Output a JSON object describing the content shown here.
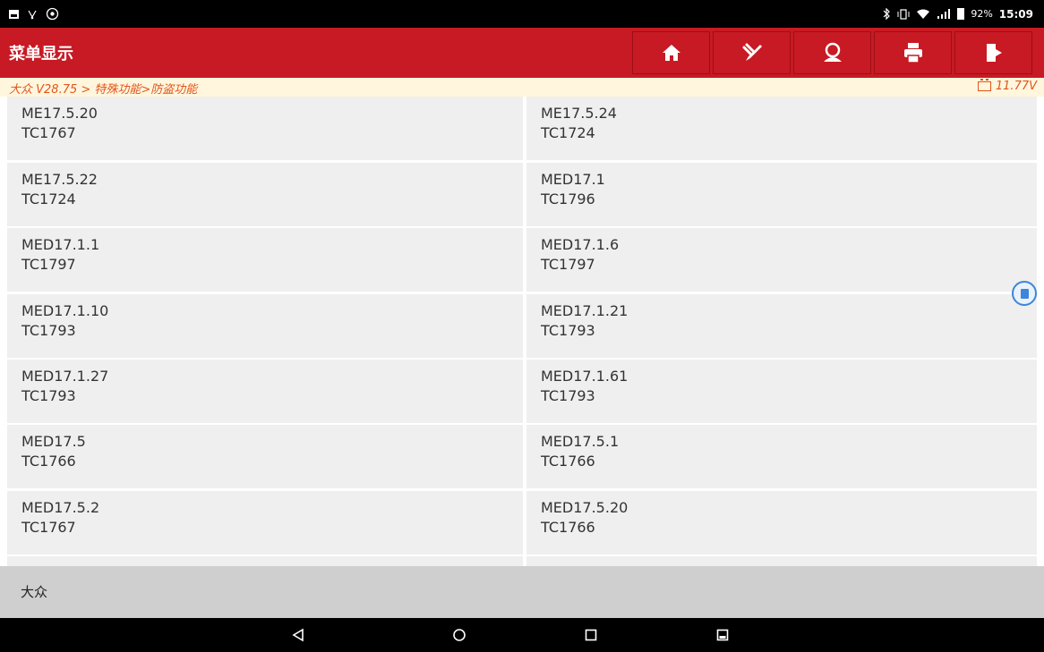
{
  "status_bar": {
    "icons": [
      "image-icon",
      "usb-icon",
      "settings-cog-icon",
      "bluetooth-icon",
      "vibrate-icon",
      "wifi-icon",
      "signal-icon",
      "battery-icon"
    ],
    "battery": "92%",
    "time": "15:09"
  },
  "title_bar": {
    "title": "菜单显示",
    "buttons": [
      "home-icon",
      "diagnose-icon",
      "support-icon",
      "print-icon",
      "exit-icon"
    ]
  },
  "breadcrumb": {
    "path": "大众 V28.75 > 特殊功能>防盗功能",
    "voltage": "11.77V"
  },
  "menu_items": [
    {
      "line1": "ME17.5.20",
      "line2": "TC1767"
    },
    {
      "line1": "ME17.5.24",
      "line2": "TC1724"
    },
    {
      "line1": "ME17.5.22",
      "line2": "TC1724"
    },
    {
      "line1": "MED17.1",
      "line2": "TC1796"
    },
    {
      "line1": "MED17.1.1",
      "line2": "TC1797"
    },
    {
      "line1": "MED17.1.6",
      "line2": "TC1797"
    },
    {
      "line1": "MED17.1.10",
      "line2": "TC1793"
    },
    {
      "line1": "MED17.1.21",
      "line2": "TC1793"
    },
    {
      "line1": "MED17.1.27",
      "line2": "TC1793"
    },
    {
      "line1": "MED17.1.61",
      "line2": "TC1793"
    },
    {
      "line1": "MED17.5",
      "line2": "TC1766"
    },
    {
      "line1": "MED17.5.1",
      "line2": "TC1766"
    },
    {
      "line1": "MED17.5.2",
      "line2": "TC1767"
    },
    {
      "line1": "MED17.5.20",
      "line2": "TC1766"
    },
    {
      "line1": "",
      "line2": ""
    },
    {
      "line1": "",
      "line2": ""
    }
  ],
  "footer": {
    "label": "大众"
  },
  "nav_bar": {
    "buttons": [
      "back-icon",
      "home-circle-icon",
      "recents-icon",
      "screenshot-icon"
    ]
  },
  "colors": {
    "title_bar": "#c71a24",
    "breadcrumb_bg": "#fff6dd",
    "breadcrumb_text": "#e2541c",
    "cell_bg": "#efefef",
    "footer_bg": "#cfcfcf",
    "float_icon": "#3d86d9"
  }
}
